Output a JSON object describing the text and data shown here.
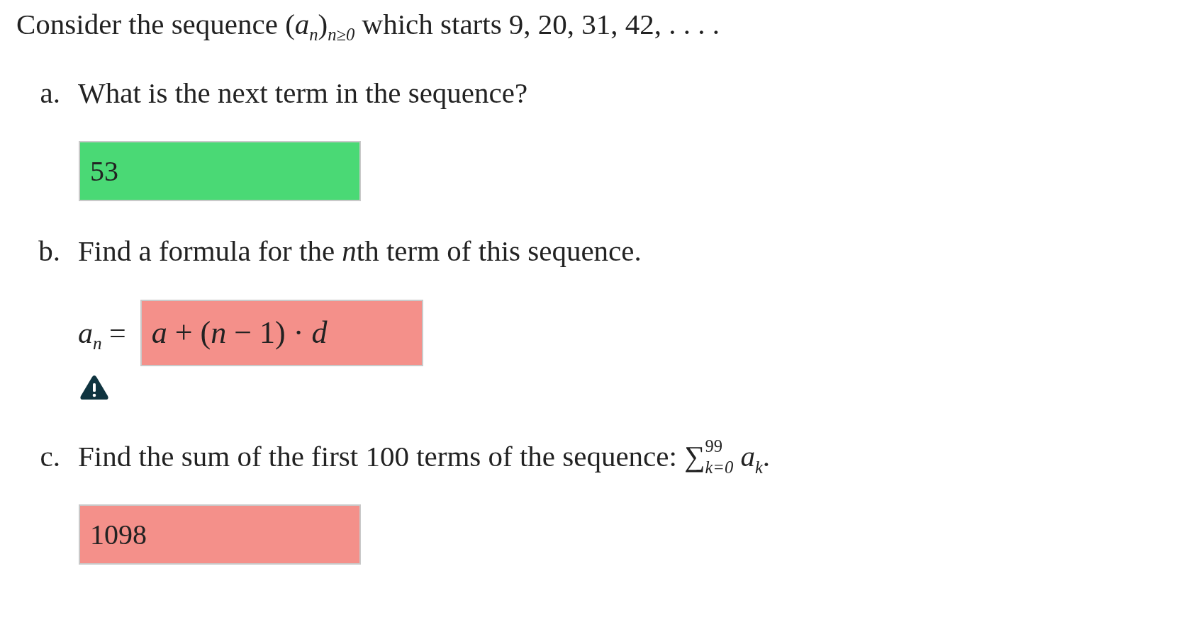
{
  "intro": [
    {
      "kind": "text",
      "text": "Consider the sequence "
    },
    {
      "kind": "math",
      "text": "(*a*$_{n}$)$_{n≥0}$"
    },
    {
      "kind": "text",
      "text": " which starts "
    },
    {
      "kind": "math",
      "text": "9, 20, 31, 42, . . . ."
    }
  ],
  "parts": [
    {
      "label": "a.",
      "prompt": [
        {
          "kind": "text",
          "text": "What is the next term in the sequence?"
        }
      ],
      "answer": {
        "kind": "plain",
        "value": "53",
        "correct": true
      },
      "warning": false
    },
    {
      "label": "b.",
      "prompt": [
        {
          "kind": "text",
          "text": "Find a formula for the "
        },
        {
          "kind": "math",
          "text": "*n*"
        },
        {
          "kind": "text",
          "text": "th term of this sequence."
        }
      ],
      "answer": {
        "kind": "formula",
        "lhs": "*a*$_{n}$ =",
        "value": "a + (n − 1) · d",
        "correct": false
      },
      "warning": true
    },
    {
      "label": "c.",
      "prompt": [
        {
          "kind": "text",
          "text": "Find the sum of the first 100 terms of the sequence: "
        },
        {
          "kind": "math",
          "text": "∑$^{99}$$_{k=0}$ *a*$_{k}$"
        },
        {
          "kind": "text",
          "text": "."
        }
      ],
      "answer": {
        "kind": "plain",
        "value": "1098",
        "correct": false
      },
      "warning": false
    }
  ]
}
